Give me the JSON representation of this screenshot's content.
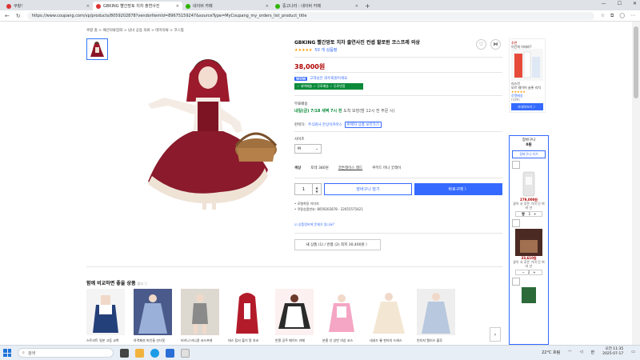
{
  "browser": {
    "tabs": [
      {
        "label": "쿠팡!",
        "active": false
      },
      {
        "label": "GBKING 빨간망토 치차 출연사진",
        "active": true
      },
      {
        "label": "네이버 카페",
        "active": false
      },
      {
        "label": "중고나라 : 네이버 카페",
        "active": false
      }
    ],
    "url": "https://www.coupang.com/vp/products/8059202878?vendorItemId=89675159247&sourceType=MyCoupang_my_orders_list_product_title"
  },
  "breadcrumb": "쿠팡 홈 > 패션의류잡화 > 남녀 공용 의류 > 테마의류 > 코스튬",
  "product": {
    "title": "GBKING 빨간망토 치차 출연사진 컨셉 할로윈 코스프레 의상",
    "stars": "★★★★★",
    "reviews": "50 개 상품평",
    "price": "38,000원",
    "wow_badge": "WOW",
    "wow_text": "고객님은 와우회원이세요",
    "benefit": "✓ 새벽배송 ✓ 무료배송 ✓ 무료반품",
    "delivery_label": "무료배송",
    "delivery_date": "내일(금) 7/18 새벽 7시 전",
    "delivery_note": "도착 보장(밤 12시 전 주문 시)",
    "seller_label": "판매자:",
    "seller_name": "주식회사 한상이커머스",
    "seller_other": "판매자 상품 보러가기",
    "size_label": "사이즈",
    "size_value": "M",
    "option_label": "색상",
    "options": [
      "토테 380원",
      "코튼레이스 레드",
      "쿠키드 머니 굿레이"
    ],
    "qty": "1",
    "cart_button": "장바구니 담기",
    "buy_button": "바로구매 〉",
    "notes": [
      "• 모델착용 이미지",
      "• 쿠팡상품번호: 8059202878 - 22655575421"
    ],
    "report": "상품정보에 문제가 있나요?",
    "all_options": "새 상품 (1) / 반품 (2) 최저 30,400원 〉"
  },
  "compare": {
    "title": "함께 비교하면 좋을 상품",
    "ad": "광고 ⓘ",
    "items": [
      "스트리트 일본 고등 교복",
      "하객패션 마인들 선녀옷",
      "비키니 비니걸 코스프레",
      "데스 탑사 불기 알 지코",
      "반팔 공주 메이드 카페",
      "분홍 선 상반 의상 코스",
      "네네드 롱 판타지 드레스",
      "빈티지 앨리스 블루"
    ]
  },
  "ad_side": {
    "tag": "추천",
    "name": "이건희 아테리?",
    "brand": "리스킨",
    "desc": "모르 레이어 슬롯 리치",
    "stars": "★★★★★",
    "rocket": "로켓배송",
    "count": "(189)",
    "button": "자세히보기 〉"
  },
  "side_cart": {
    "title": "장바구니",
    "count": "0원",
    "go": "장바구니 가기",
    "items": [
      {
        "price": "279,000원",
        "desc": "같이 사 루돈 가격 단 여러 산",
        "qty": "1"
      },
      {
        "price": "33,610원",
        "desc": "같이 사 루돈 가격 단 여러 산",
        "qty": "2"
      }
    ]
  },
  "taskbar": {
    "search_placeholder": "검색",
    "weather": "22°C 흐림",
    "lang": "한",
    "time": "오전 11:35",
    "date": "2025-07-17"
  }
}
